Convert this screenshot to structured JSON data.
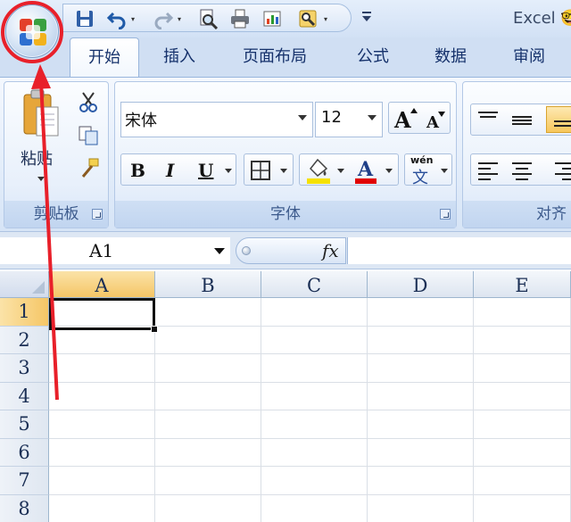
{
  "title_bar": {
    "app_title": "Excel 🤓",
    "quick_access": {
      "save_icon": "save-icon",
      "undo_icon": "undo-icon",
      "redo_icon": "redo-icon",
      "print_preview_icon": "print-preview-icon",
      "print_icon": "print-icon",
      "chart_icon": "chart-icon",
      "tools_icon": "tools-icon"
    }
  },
  "tabs": [
    {
      "label": "开始",
      "active": true
    },
    {
      "label": "插入"
    },
    {
      "label": "页面布局"
    },
    {
      "label": "公式"
    },
    {
      "label": "数据"
    },
    {
      "label": "审阅"
    }
  ],
  "ribbon": {
    "clipboard": {
      "label": "剪贴板",
      "paste_label": "粘贴"
    },
    "font": {
      "label": "字体",
      "font_name": "宋体",
      "font_size": "12",
      "bold": "B",
      "italic": "I",
      "underline": "U",
      "font_color_glyph": "A",
      "phonetic_top": "wén",
      "phonetic_char": "文",
      "highlight_color": "#f5e100",
      "font_color": "#e00000"
    },
    "alignment": {
      "label": "对齐"
    }
  },
  "formula_bar": {
    "name_box": "A1",
    "fx": "fx",
    "content": ""
  },
  "sheet": {
    "columns": [
      "A",
      "B",
      "C",
      "D",
      "E"
    ],
    "rows": [
      "1",
      "2",
      "3",
      "4",
      "5",
      "6",
      "7",
      "8"
    ],
    "selected_column": "A",
    "selected_row": "1"
  },
  "colors": {
    "annotation": "#e8202a",
    "selection_header": "#f5c666",
    "ribbon_text": "#15316b"
  }
}
